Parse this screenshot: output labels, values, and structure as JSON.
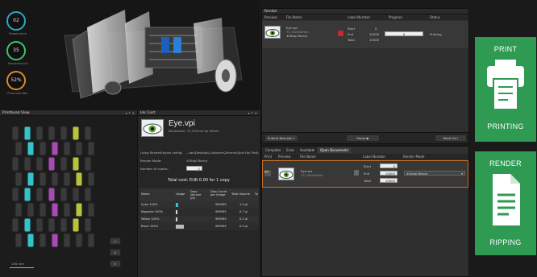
{
  "machine": {
    "gauges": [
      {
        "value": "02",
        "label": "Temperature"
      },
      {
        "value": "35",
        "label": "Temperature/F"
      },
      {
        "value": "52%",
        "label": "Pressure/mBar"
      }
    ],
    "colors": {
      "g1": "#2aa8c8",
      "g2": "#43c06a",
      "g3": "#e08a28"
    }
  },
  "printhead": {
    "title": "Printhead View",
    "controls": "▾ ↑ ✕",
    "scale": "100 mm",
    "zoom_buttons": [
      "search-icon",
      "search-icon",
      "search-icon"
    ],
    "colors": {
      "cyan": "#35c2c8",
      "magenta": "#a74ab3",
      "yellow": "#b9c23a",
      "black": "#3b3b3b"
    }
  },
  "inkcost": {
    "title": "Ink Cost",
    "controls": "▾ ↑ ✕",
    "file_name": "Eye.vpi",
    "dimension": "Dimension: 72,192mm by 50mm",
    "config_label": "Using RenderEngine config:",
    "config_path": "...ker\\Desktop\\Customer\\Zimmer\\Spin Fail Test\\P",
    "render_mode_label": "Render Mode:",
    "render_mode": "400dpi Binary",
    "copies_label": "Number of copies:",
    "copies": "1",
    "total": "Total cost: EUR 0.00 for 1 copy",
    "headers": [
      "Name",
      "Usage",
      "Drop Volume (pl)",
      "Drop Count per image",
      "Total Volume",
      "To"
    ],
    "rows": [
      {
        "name": "Cyan 100%",
        "drop_count": "969395",
        "volume": "1.0 µl"
      },
      {
        "name": "Magenta 100%",
        "drop_count": "969395",
        "volume": "0.7 µl"
      },
      {
        "name": "Yellow 100%",
        "drop_count": "969395",
        "volume": "0.2 µl"
      },
      {
        "name": "Black 100%",
        "drop_count": "969395",
        "volume": "0.9 µl"
      }
    ]
  },
  "render": {
    "title": "Render",
    "headers": [
      "Preview",
      "File Name",
      "Label Number",
      "Progress",
      "Status"
    ],
    "job": {
      "name": "Eye.vpi",
      "dim": "72,192x50mm",
      "mode": "400dpi Binary",
      "start_label": "Start",
      "start": "0",
      "end_label": "End",
      "end": "10000",
      "total_label": "Total",
      "total": "10000",
      "progress": "0",
      "status": "Printing"
    },
    "submit": "Submit New Job",
    "pause": "Pause",
    "abort": "Abort All"
  },
  "docs": {
    "tabs": [
      "Complete",
      "Error",
      "Available",
      "Open Documents"
    ],
    "active_tab": 3,
    "headers": [
      "Print",
      "Preview",
      "File Name",
      "Label Number",
      "Render Mode"
    ],
    "job": {
      "name": "Eye.vpi",
      "dim": "72,192x50mm",
      "start_label": "Start",
      "start": "0",
      "end_label": "End",
      "end": "10000",
      "total_label": "Total",
      "total": "10000",
      "mode": "400dpi Binary"
    }
  },
  "side": {
    "print_label": "PRINT",
    "print_status": "PRINTING",
    "render_label": "RENDER",
    "render_status": "RIPPING",
    "color": "#2e9a52"
  }
}
